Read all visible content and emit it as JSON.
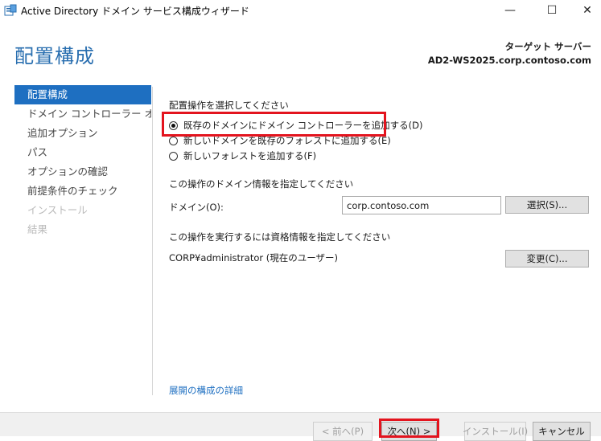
{
  "window": {
    "title": "Active Directory ドメイン サービス構成ウィザード",
    "minimize": "—",
    "maximize": "☐",
    "close": "✕"
  },
  "header": {
    "page_title": "配置構成",
    "target_label": "ターゲット サーバー",
    "target_server": "AD2-WS2025.corp.contoso.com"
  },
  "nav": {
    "items": [
      {
        "label": "配置構成",
        "state": "active"
      },
      {
        "label": "ドメイン コントローラー オプション",
        "state": "normal"
      },
      {
        "label": "追加オプション",
        "state": "normal"
      },
      {
        "label": "パス",
        "state": "normal"
      },
      {
        "label": "オプションの確認",
        "state": "normal"
      },
      {
        "label": "前提条件のチェック",
        "state": "normal"
      },
      {
        "label": "インストール",
        "state": "disabled"
      },
      {
        "label": "結果",
        "state": "disabled"
      }
    ]
  },
  "main": {
    "deploy_heading": "配置操作を選択してください",
    "options": [
      {
        "label": "既存のドメインにドメイン コントローラーを追加する(D)",
        "checked": true
      },
      {
        "label": "新しいドメインを既存のフォレストに追加する(E)",
        "checked": false
      },
      {
        "label": "新しいフォレストを追加する(F)",
        "checked": false
      }
    ],
    "domain_heading": "この操作のドメイン情報を指定してください",
    "domain_label": "ドメイン(O):",
    "domain_value": "corp.contoso.com",
    "select_button": "選択(S)...",
    "cred_heading": "この操作を実行するには資格情報を指定してください",
    "cred_user": "CORP¥administrator (現在のユーザー)",
    "change_button": "変更(C)...",
    "more_link": "展開の構成の詳細"
  },
  "footer": {
    "back": "< 前へ(P)",
    "next": "次へ(N) >",
    "install": "インストール(I)",
    "cancel": "キャンセル"
  }
}
